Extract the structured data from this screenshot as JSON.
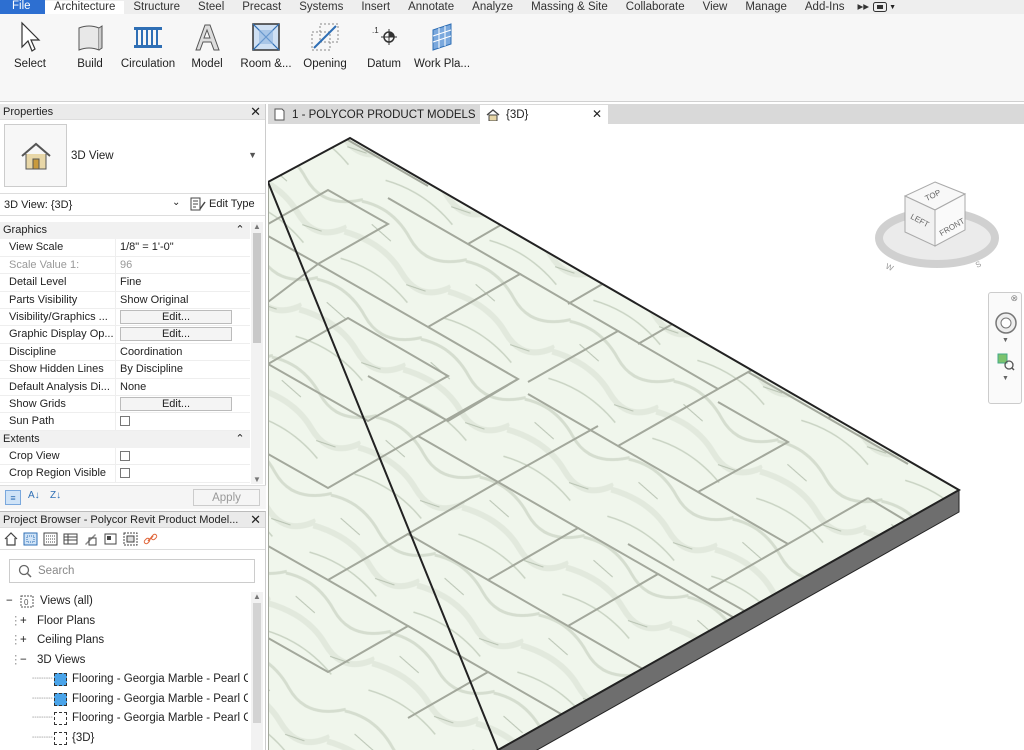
{
  "menu": {
    "file": "File",
    "tabs": [
      "Architecture",
      "Structure",
      "Steel",
      "Precast",
      "Systems",
      "Insert",
      "Annotate",
      "Analyze",
      "Massing & Site",
      "Collaborate",
      "View",
      "Manage",
      "Add-Ins"
    ],
    "active_tab": "Architecture"
  },
  "ribbon": {
    "buttons": [
      {
        "label": "Select",
        "icon": "cursor-icon"
      },
      {
        "label": "Build",
        "icon": "wall-icon"
      },
      {
        "label": "Circulation",
        "icon": "railing-icon"
      },
      {
        "label": "Model",
        "icon": "model-text-icon"
      },
      {
        "label": "Room &...",
        "icon": "room-icon"
      },
      {
        "label": "Opening",
        "icon": "opening-icon"
      },
      {
        "label": "Datum",
        "icon": "datum-icon"
      },
      {
        "label": "Work Pla...",
        "icon": "work-plane-icon"
      }
    ]
  },
  "properties": {
    "title": "Properties",
    "type_name": "3D View",
    "selector": "3D View: {3D}",
    "edit_type": "Edit Type",
    "rows": [
      {
        "group": "Graphics"
      },
      {
        "k": "View Scale",
        "v": "1/8\" = 1'-0\""
      },
      {
        "k": "Scale Value    1:",
        "v": "96",
        "dim": true
      },
      {
        "k": "Detail Level",
        "v": "Fine"
      },
      {
        "k": "Parts Visibility",
        "v": "Show Original"
      },
      {
        "k": "Visibility/Graphics ...",
        "btn": "Edit..."
      },
      {
        "k": "Graphic Display Op...",
        "btn": "Edit..."
      },
      {
        "k": "Discipline",
        "v": "Coordination"
      },
      {
        "k": "Show Hidden Lines",
        "v": "By Discipline"
      },
      {
        "k": "Default Analysis Di...",
        "v": "None"
      },
      {
        "k": "Show Grids",
        "btn": "Edit..."
      },
      {
        "k": "Sun Path",
        "check": true
      },
      {
        "group": "Extents"
      },
      {
        "k": "Crop View",
        "check": true
      },
      {
        "k": "Crop Region Visible",
        "check": true
      }
    ],
    "apply": "Apply"
  },
  "project_browser": {
    "title": "Project Browser - Polycor Revit Product Model...",
    "search_placeholder": "Search",
    "tree": [
      {
        "label": "Views (all)",
        "level": 0,
        "toggle": "−",
        "icon": "views-icon"
      },
      {
        "label": "Floor Plans",
        "level": 1,
        "toggle": "+"
      },
      {
        "label": "Ceiling Plans",
        "level": 1,
        "toggle": "+"
      },
      {
        "label": "3D Views",
        "level": 1,
        "toggle": "−"
      },
      {
        "label": "Flooring - Georgia Marble - Pearl C",
        "level": 2,
        "icon": "3d-view-blue-icon"
      },
      {
        "label": "Flooring - Georgia Marble - Pearl C",
        "level": 2,
        "icon": "3d-view-blue-icon"
      },
      {
        "label": "Flooring - Georgia Marble - Pearl C",
        "level": 2,
        "icon": "3d-view-icon"
      },
      {
        "label": "{3D}",
        "level": 2,
        "icon": "3d-view-icon"
      }
    ]
  },
  "viewport": {
    "tab1": "1 - POLYCOR PRODUCT MODELS",
    "tab2": "{3D}",
    "viewcube": {
      "top": "TOP",
      "left": "LEFT",
      "front": "FRONT"
    }
  }
}
